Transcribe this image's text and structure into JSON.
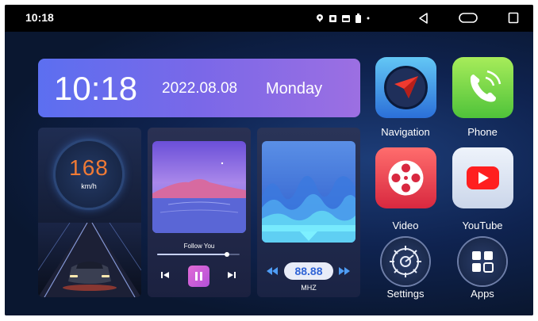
{
  "status_bar": {
    "time": "10:18",
    "icons": [
      "gps-icon",
      "media-icon",
      "image-icon",
      "battery-icon",
      "dot-icon"
    ],
    "nav": [
      "back-icon",
      "home-icon",
      "recents-icon"
    ]
  },
  "clock_widget": {
    "time": "10:18",
    "date": "2022.08.08",
    "day": "Monday"
  },
  "speed_widget": {
    "value": "168",
    "unit": "km/h"
  },
  "music_widget": {
    "song_title": "Follow You",
    "progress": 0.85
  },
  "radio_widget": {
    "frequency": "88.88",
    "unit": "MHZ"
  },
  "apps": [
    {
      "label": "Navigation",
      "icon": "navigation-arrow-icon"
    },
    {
      "label": "Phone",
      "icon": "phone-icon"
    },
    {
      "label": "Video",
      "icon": "film-reel-icon"
    },
    {
      "label": "YouTube",
      "icon": "youtube-play-icon"
    },
    {
      "label": "Settings",
      "icon": "gear-icon"
    },
    {
      "label": "Apps",
      "icon": "grid-icon"
    }
  ],
  "colors": {
    "clock_gradient_start": "#5c6ff0",
    "clock_gradient_end": "#9c6fe2",
    "speed_value": "#f07a35",
    "frequency_text": "#2f63d6",
    "play_button": "#d05fd8"
  }
}
